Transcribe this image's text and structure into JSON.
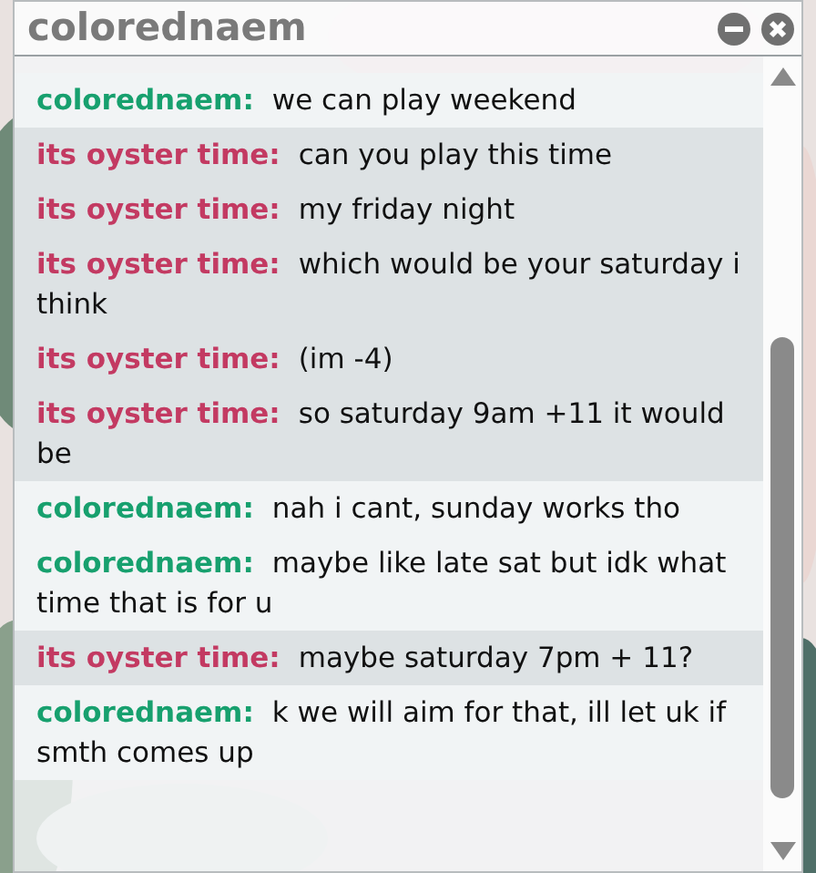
{
  "window": {
    "title": "colorednaem"
  },
  "messages": [
    {
      "kind": "me",
      "sender": "colorednaem:",
      "text": "we can play weekend"
    },
    {
      "kind": "them",
      "sender": "its oyster time:",
      "text": "can you play this time"
    },
    {
      "kind": "them",
      "sender": "its oyster time:",
      "text": "my friday night"
    },
    {
      "kind": "them",
      "sender": "its oyster time:",
      "text": "which would be your saturday i think"
    },
    {
      "kind": "them",
      "sender": "its oyster time:",
      "text": "(im -4)"
    },
    {
      "kind": "them",
      "sender": "its oyster time:",
      "text": "so saturday 9am +11 it would be"
    },
    {
      "kind": "me",
      "sender": "colorednaem:",
      "text": "nah i cant, sunday works tho"
    },
    {
      "kind": "me",
      "sender": "colorednaem:",
      "text": "maybe like late sat but idk what time that is for u"
    },
    {
      "kind": "them",
      "sender": "its oyster time:",
      "text": "maybe saturday 7pm + 11?"
    },
    {
      "kind": "me",
      "sender": "colorednaem:",
      "text": "k we will aim for that, ill let uk if smth comes up"
    }
  ]
}
